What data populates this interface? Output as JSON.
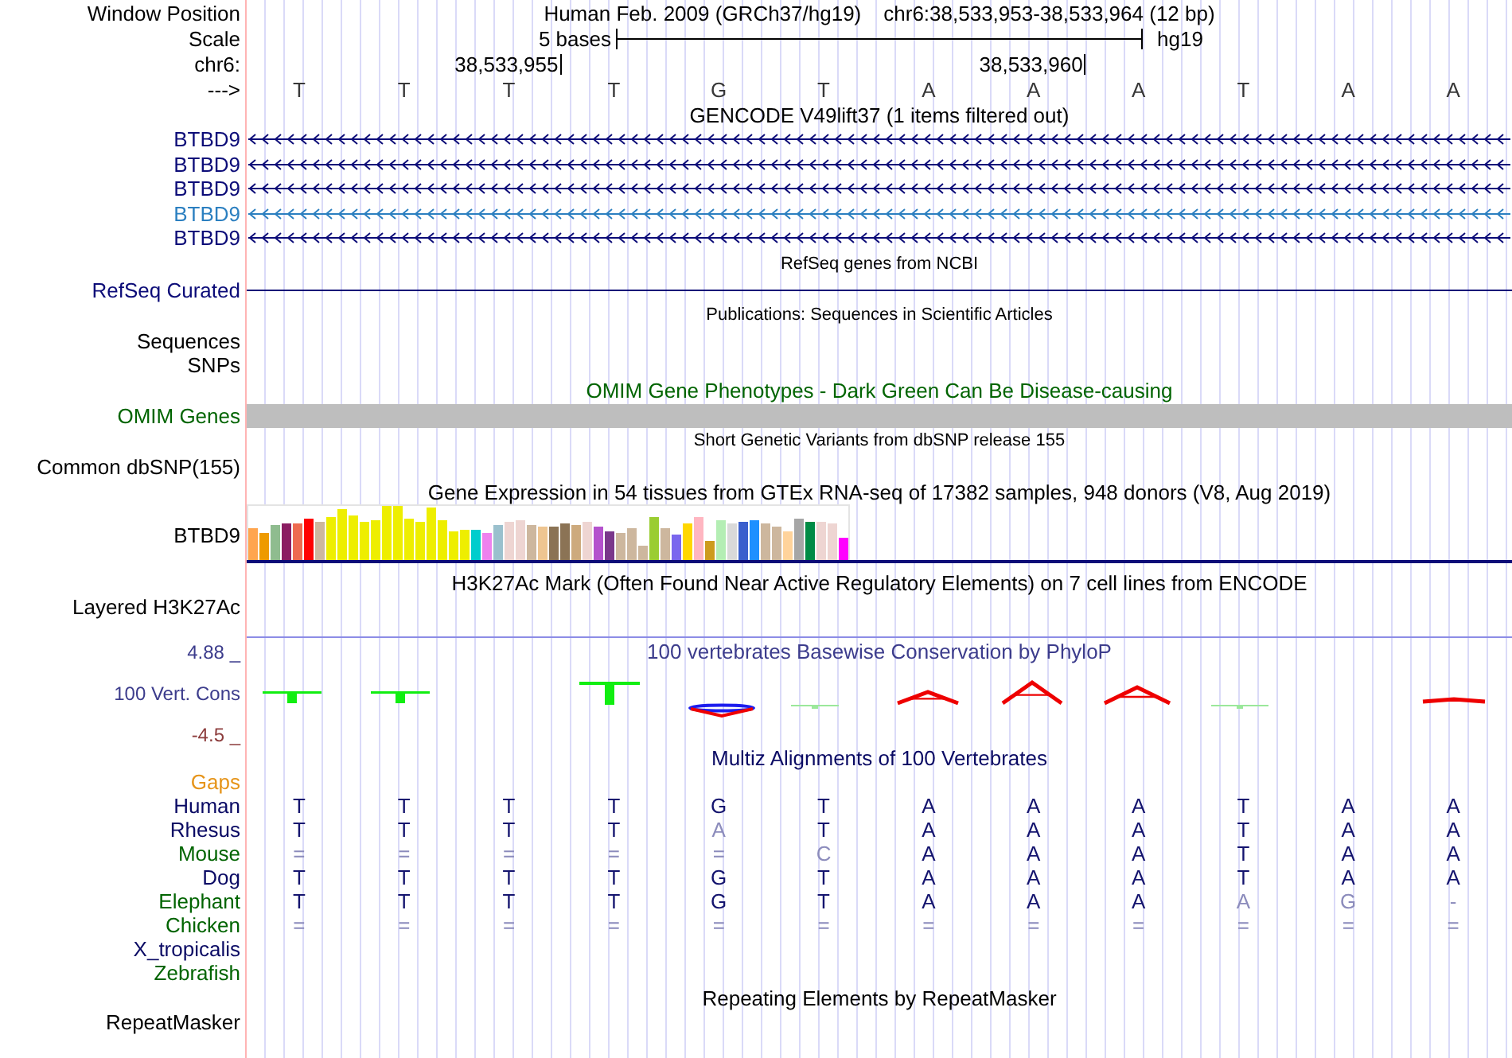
{
  "header": {
    "position_label": "Window Position",
    "assembly": "Human Feb. 2009 (GRCh37/hg19)",
    "position": "chr6:38,533,953-38,533,964 (12 bp)",
    "scale_label": "Scale",
    "scale_text": "5 bases",
    "scale_assembly": "hg19",
    "chrom_label": "chr6:",
    "ticks": [
      "38,533,955",
      "38,533,960"
    ],
    "strand_label": "--->",
    "bases": [
      "T",
      "T",
      "T",
      "T",
      "G",
      "T",
      "A",
      "A",
      "A",
      "T",
      "A",
      "A"
    ]
  },
  "tracks": [
    {
      "kind": "genes",
      "title": "GENCODE V49lift37 (1 items filtered out)",
      "items": [
        {
          "label": "BTBD9",
          "color": "#0c0c78"
        },
        {
          "label": "BTBD9",
          "color": "#0c0c78"
        },
        {
          "label": "BTBD9",
          "color": "#0c0c78"
        },
        {
          "label": "BTBD9",
          "color": "#2b7fc0"
        },
        {
          "label": "BTBD9",
          "color": "#0c0c78"
        }
      ]
    },
    {
      "kind": "line",
      "title": "RefSeq genes from NCBI",
      "label": "RefSeq Curated",
      "color": "#0c0c78"
    },
    {
      "kind": "compact",
      "title": "Publications: Sequences in Scientific Articles",
      "labels": [
        "Sequences",
        "SNPs"
      ]
    },
    {
      "kind": "block",
      "title": "OMIM Gene Phenotypes - Dark Green Can Be Disease-causing",
      "label": "OMIM Genes",
      "color": "#006400"
    },
    {
      "kind": "compact",
      "title": "Short Genetic Variants from dbSNP release 155",
      "labels": [
        "Common dbSNP(155)"
      ]
    },
    {
      "kind": "expression",
      "title": "Gene Expression in 54 tissues from GTEx RNA-seq of 17382 samples, 948 donors (V8, Aug 2019)",
      "label": "BTBD9"
    },
    {
      "kind": "blank",
      "title": "H3K27Ac Mark (Often Found Near Active Regulatory Elements) on 7 cell lines from ENCODE",
      "label": "Layered H3K27Ac"
    },
    {
      "kind": "conservation",
      "title": "100 vertebrates Basewise Conservation by PhyloP",
      "label": "100 Vert. Cons",
      "max_label": "4.88 _",
      "min_label": "-4.5 _",
      "color": "#3c3c8c"
    },
    {
      "kind": "alignment",
      "title": "Multiz Alignments of 100 Vertebrates",
      "gaps_label": "Gaps",
      "species": [
        {
          "name": "Human",
          "color": "#0a0a64",
          "bases": [
            {
              "base": "T",
              "faded": false
            },
            {
              "base": "T",
              "faded": false
            },
            {
              "base": "T",
              "faded": false
            },
            {
              "base": "T",
              "faded": false
            },
            {
              "base": "G",
              "faded": false
            },
            {
              "base": "T",
              "faded": false
            },
            {
              "base": "A",
              "faded": false
            },
            {
              "base": "A",
              "faded": false
            },
            {
              "base": "A",
              "faded": false
            },
            {
              "base": "T",
              "faded": false
            },
            {
              "base": "A",
              "faded": false
            },
            {
              "base": "A",
              "faded": false
            }
          ]
        },
        {
          "name": "Rhesus",
          "color": "#0a0a64",
          "bases": [
            {
              "base": "T",
              "faded": false
            },
            {
              "base": "T",
              "faded": false
            },
            {
              "base": "T",
              "faded": false
            },
            {
              "base": "T",
              "faded": false
            },
            {
              "base": "A",
              "faded": true
            },
            {
              "base": "T",
              "faded": false
            },
            {
              "base": "A",
              "faded": false
            },
            {
              "base": "A",
              "faded": false
            },
            {
              "base": "A",
              "faded": false
            },
            {
              "base": "T",
              "faded": false
            },
            {
              "base": "A",
              "faded": false
            },
            {
              "base": "A",
              "faded": false
            }
          ]
        },
        {
          "name": "Mouse",
          "color": "#006400",
          "bases": [
            {
              "base": "=",
              "faded": true
            },
            {
              "base": "=",
              "faded": true
            },
            {
              "base": "=",
              "faded": true
            },
            {
              "base": "=",
              "faded": true
            },
            {
              "base": "=",
              "faded": true
            },
            {
              "base": "C",
              "faded": true
            },
            {
              "base": "A",
              "faded": false
            },
            {
              "base": "A",
              "faded": false
            },
            {
              "base": "A",
              "faded": false
            },
            {
              "base": "T",
              "faded": false
            },
            {
              "base": "A",
              "faded": false
            },
            {
              "base": "A",
              "faded": false
            }
          ]
        },
        {
          "name": "Dog",
          "color": "#0a0a64",
          "bases": [
            {
              "base": "T",
              "faded": false
            },
            {
              "base": "T",
              "faded": false
            },
            {
              "base": "T",
              "faded": false
            },
            {
              "base": "T",
              "faded": false
            },
            {
              "base": "G",
              "faded": false
            },
            {
              "base": "T",
              "faded": false
            },
            {
              "base": "A",
              "faded": false
            },
            {
              "base": "A",
              "faded": false
            },
            {
              "base": "A",
              "faded": false
            },
            {
              "base": "T",
              "faded": false
            },
            {
              "base": "A",
              "faded": false
            },
            {
              "base": "A",
              "faded": false
            }
          ]
        },
        {
          "name": "Elephant",
          "color": "#006400",
          "bases": [
            {
              "base": "T",
              "faded": false
            },
            {
              "base": "T",
              "faded": false
            },
            {
              "base": "T",
              "faded": false
            },
            {
              "base": "T",
              "faded": false
            },
            {
              "base": "G",
              "faded": false
            },
            {
              "base": "T",
              "faded": false
            },
            {
              "base": "A",
              "faded": false
            },
            {
              "base": "A",
              "faded": false
            },
            {
              "base": "A",
              "faded": false
            },
            {
              "base": "A",
              "faded": true
            },
            {
              "base": "G",
              "faded": true
            },
            {
              "base": "-",
              "faded": true
            }
          ]
        },
        {
          "name": "Chicken",
          "color": "#006400",
          "bases": [
            {
              "base": "=",
              "faded": true
            },
            {
              "base": "=",
              "faded": true
            },
            {
              "base": "=",
              "faded": true
            },
            {
              "base": "=",
              "faded": true
            },
            {
              "base": "=",
              "faded": true
            },
            {
              "base": "=",
              "faded": true
            },
            {
              "base": "=",
              "faded": true
            },
            {
              "base": "=",
              "faded": true
            },
            {
              "base": "=",
              "faded": true
            },
            {
              "base": "=",
              "faded": true
            },
            {
              "base": "=",
              "faded": true
            },
            {
              "base": "=",
              "faded": true
            }
          ]
        },
        {
          "name": "X_tropicalis",
          "color": "#0a0a64"
        },
        {
          "name": "Zebrafish",
          "color": "#006400"
        }
      ]
    },
    {
      "kind": "blank",
      "title": "Repeating Elements by RepeatMasker",
      "label": "RepeatMasker"
    }
  ]
}
